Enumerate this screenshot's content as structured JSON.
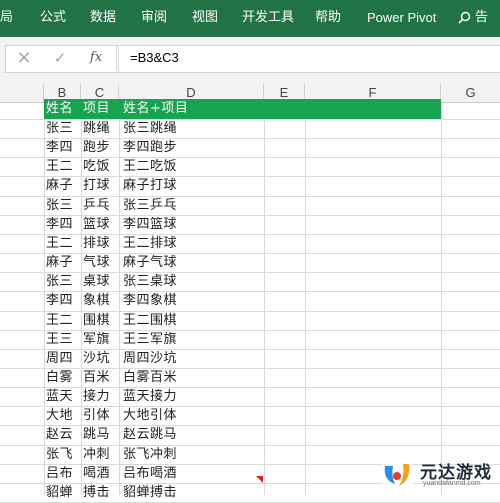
{
  "ribbon": {
    "tabs": [
      "局",
      "公式",
      "数据",
      "审阅",
      "视图",
      "开发工具",
      "帮助",
      "Power Pivot"
    ],
    "search_label": "告",
    "color": "#217346"
  },
  "formula_bar": {
    "cancel_icon": "×",
    "enter_icon": "✓",
    "fx_label": "fx",
    "formula": "=B3&C3"
  },
  "columns": [
    "B",
    "C",
    "D",
    "E",
    "F",
    "G"
  ],
  "sheet": {
    "header": {
      "name": "姓名",
      "item": "项目",
      "combined": "姓名+项目"
    },
    "header_color": "#17a34f",
    "rows": [
      {
        "name": "张三",
        "item": "跳绳",
        "combined": "张三跳绳"
      },
      {
        "name": "李四",
        "item": "跑步",
        "combined": "李四跑步"
      },
      {
        "name": "王二",
        "item": "吃饭",
        "combined": "王二吃饭"
      },
      {
        "name": "麻子",
        "item": "打球",
        "combined": "麻子打球"
      },
      {
        "name": "张三",
        "item": "乒乓",
        "combined": "张三乒乓"
      },
      {
        "name": "李四",
        "item": "篮球",
        "combined": "李四篮球"
      },
      {
        "name": "王二",
        "item": "排球",
        "combined": "王二排球"
      },
      {
        "name": "麻子",
        "item": "气球",
        "combined": "麻子气球"
      },
      {
        "name": "张三",
        "item": "桌球",
        "combined": "张三桌球"
      },
      {
        "name": "李四",
        "item": "象棋",
        "combined": "李四象棋"
      },
      {
        "name": "王二",
        "item": "围棋",
        "combined": "王二围棋"
      },
      {
        "name": "王三",
        "item": "军旗",
        "combined": "王三军旗"
      },
      {
        "name": "周四",
        "item": "沙坑",
        "combined": "周四沙坑"
      },
      {
        "name": "白雾",
        "item": "百米",
        "combined": "白雾百米"
      },
      {
        "name": "蓝天",
        "item": "接力",
        "combined": "蓝天接力"
      },
      {
        "name": "大地",
        "item": "引体",
        "combined": "大地引体"
      },
      {
        "name": "赵云",
        "item": "跳马",
        "combined": "赵云跳马"
      },
      {
        "name": "张飞",
        "item": "冲刺",
        "combined": "张飞冲刺"
      },
      {
        "name": "吕布",
        "item": "喝酒",
        "combined": "吕布喝酒"
      },
      {
        "name": "貂蝉",
        "item": "搏击",
        "combined": "貂蝉搏击"
      }
    ]
  },
  "watermark": {
    "name": "元达游戏",
    "url": "yuandafanmd.com"
  }
}
